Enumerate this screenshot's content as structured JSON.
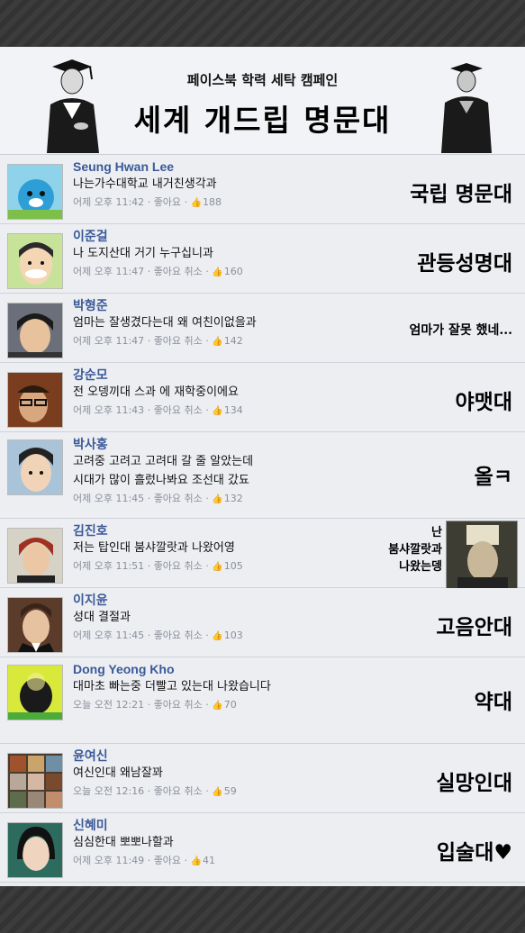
{
  "header": {
    "subtitle": "페이스북 학력 세탁 캠페인",
    "title": "세계 개드립 명문대"
  },
  "comments": [
    {
      "name": "Seung Hwan Lee",
      "text": "나는가수대학교 내거친생각과",
      "time": "어제 오후 11:42",
      "like_label": "좋아요",
      "likes": "188",
      "caption": "국립 명문대"
    },
    {
      "name": "이준걸",
      "text": "나 도지산대 거기 누구십니과",
      "time": "어제 오후 11:47",
      "like_label": "좋아요 취소",
      "likes": "160",
      "caption": "관등성명대"
    },
    {
      "name": "박형준",
      "text": "엄마는 잘생겼다는대 왜 여친이없을과",
      "time": "어제 오후 11:47",
      "like_label": "좋아요 취소",
      "likes": "142",
      "caption": "엄마가 잘못 했네..."
    },
    {
      "name": "강순모",
      "text": "전 오뎅끼대 스과 에 재학중이에요",
      "time": "어제 오후 11:43",
      "like_label": "좋아요 취소",
      "likes": "134",
      "caption": "야맷대"
    },
    {
      "name": "박사홍",
      "text": "고려중 고려고 고려대 갈 줄 알았는데\n시대가 많이 흘렀나봐요 조선대 갔됴",
      "time": "어제 오후 11:45",
      "like_label": "좋아요 취소",
      "likes": "132",
      "caption": "올ㅋ"
    },
    {
      "name": "김진호",
      "text": "저는 탑인대 붐샤깔랏과 나왔어영",
      "time": "어제 오후 11:51",
      "like_label": "좋아요 취소",
      "likes": "105",
      "caption": "난\n붐샤깔랏과\n나왔는뎅"
    },
    {
      "name": "이지윤",
      "text": "성대 결절과",
      "time": "어제 오후 11:45",
      "like_label": "좋아요 취소",
      "likes": "103",
      "caption": "고음안대"
    },
    {
      "name": "Dong Yeong Kho",
      "text": "대마초 빠는중 더빨고 있는대 나왔습니다",
      "time": "오늘 오전 12:21",
      "like_label": "좋아요 취소",
      "likes": "70",
      "caption": "약대"
    },
    {
      "name": "윤여신",
      "text": "여신인대 왜남잘꽈",
      "time": "오늘 오전 12:16",
      "like_label": "좋아요 취소",
      "likes": "59",
      "caption": "실망인대"
    },
    {
      "name": "신혜미",
      "text": "심심한대 뽀뽀나할과",
      "time": "어제 오후 11:49",
      "like_label": "좋아요",
      "likes": "41",
      "caption": "입술대♥"
    }
  ],
  "meta_separator": "·"
}
